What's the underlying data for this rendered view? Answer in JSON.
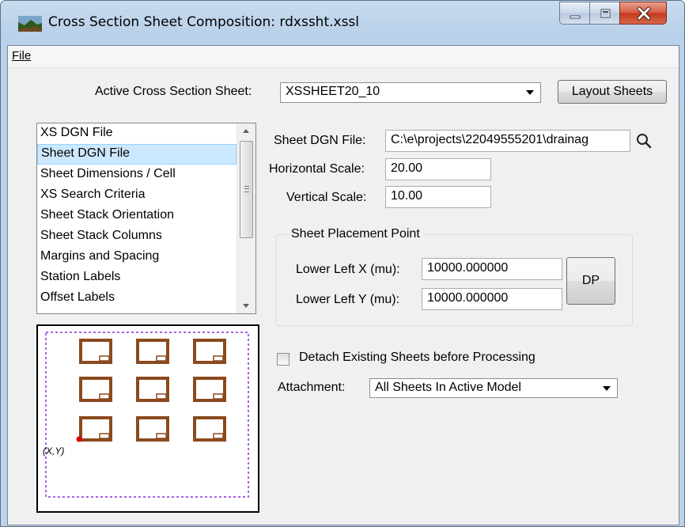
{
  "window": {
    "title": "Cross Section Sheet Composition: rdxssht.xssl"
  },
  "menu": {
    "file_label": "File"
  },
  "active_sheet": {
    "label": "Active Cross Section Sheet:",
    "value": "XSSHEET20_10"
  },
  "layout_button_label": "Layout Sheets",
  "categories": {
    "items": [
      "XS DGN File",
      "Sheet DGN File",
      "Sheet Dimensions / Cell",
      "XS Search Criteria",
      "Sheet Stack Orientation",
      "Sheet Stack Columns",
      "Margins and Spacing",
      "Station Labels",
      "Offset Labels"
    ],
    "selected": "Sheet DGN File"
  },
  "sheet_dgn_file": {
    "label": "Sheet DGN File:",
    "value": "C:\\e\\projects\\22049555201\\drainag"
  },
  "horizontal_scale": {
    "label": "Horizontal Scale:",
    "value": "20.00"
  },
  "vertical_scale": {
    "label": "Vertical Scale:",
    "value": "10.00"
  },
  "placement": {
    "title": "Sheet Placement Point",
    "x_label": "Lower Left X (mu):",
    "x_value": "10000.000000",
    "y_label": "Lower Left Y (mu):",
    "y_value": "10000.000000",
    "dp_label": "DP"
  },
  "detach": {
    "label": "Detach Existing Sheets before Processing",
    "checked": false
  },
  "attachment": {
    "label": "Attachment:",
    "value": "All Sheets In Active Model"
  },
  "preview": {
    "origin_label": "(X,Y)"
  },
  "icons": {
    "app": "cross-section-app-icon",
    "search": "search-icon",
    "minimize": "minimize-icon",
    "maximize": "maximize-icon",
    "close": "close-icon"
  },
  "colors": {
    "sheet_outline": "#8a4a1e",
    "margin_dash": "#8b2be2",
    "origin_point": "#e00000",
    "selection": "#cce8ff"
  }
}
